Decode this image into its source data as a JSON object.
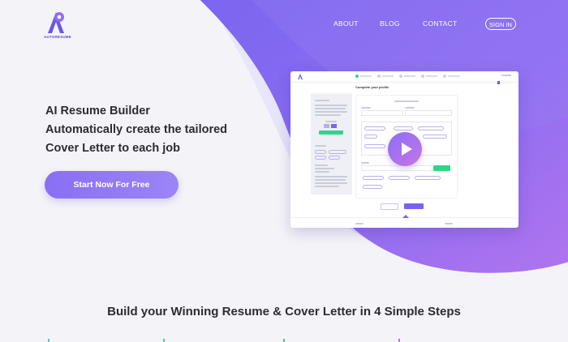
{
  "brand": {
    "name": "AUTORESUME",
    "accent": "#7b61f2",
    "accent_light": "#a995f7",
    "dark_text": "#2b2b34"
  },
  "nav": {
    "about": "ABOUT",
    "blog": "BLOG",
    "contact": "CONTACT",
    "sign_in": "SIGN IN"
  },
  "hero": {
    "line1": "AI Resume Builder",
    "line2": "Automatically create the tailored",
    "line3": "Cover Letter to each job",
    "cta_label": "Start Now For Free"
  },
  "preview": {
    "profile_title": "Complete your profile",
    "video_control": "play-icon"
  },
  "steps": {
    "title": "Build your Winning Resume & Cover Letter in 4 Simple Steps"
  }
}
